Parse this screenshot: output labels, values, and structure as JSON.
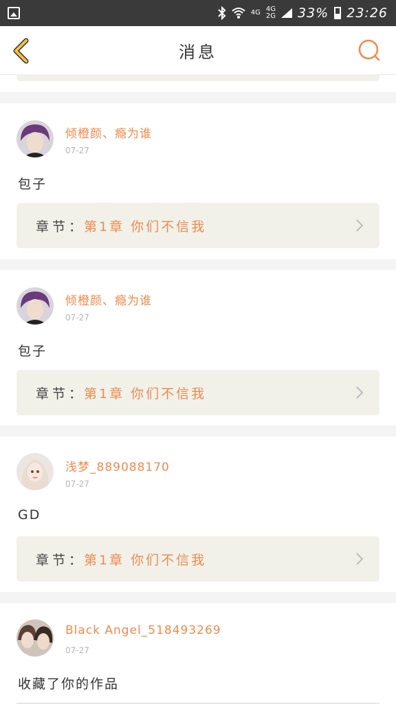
{
  "status_bar": {
    "network": "4G",
    "network_dual_top": "4G",
    "network_dual_bottom": "2G",
    "battery": "33%",
    "time": "23:26",
    "icons": [
      "image-icon",
      "bluetooth-icon",
      "wifi-icon",
      "signal-icon",
      "battery-icon"
    ]
  },
  "header": {
    "title": "消息",
    "back_icon": "chevron-left-icon",
    "search_icon": "search-icon",
    "accent_color": "#f5c242",
    "search_color": "#f08a4b"
  },
  "messages": [
    {
      "username": "倾橙颜、瘾为谁",
      "time": "07-27",
      "content": "包子",
      "chapter_label": "章节：",
      "chapter_title": "第1章 你们不信我"
    },
    {
      "username": "倾橙颜、瘾为谁",
      "time": "07-27",
      "content": "包子",
      "chapter_label": "章节：",
      "chapter_title": "第1章 你们不信我"
    },
    {
      "username": "浅梦_889088170",
      "time": "07-27",
      "content": "GD",
      "chapter_label": "章节：",
      "chapter_title": "第1章 你们不信我"
    },
    {
      "username": "Black Angel_518493269",
      "time": "07-27",
      "content": "收藏了你的作品"
    }
  ]
}
